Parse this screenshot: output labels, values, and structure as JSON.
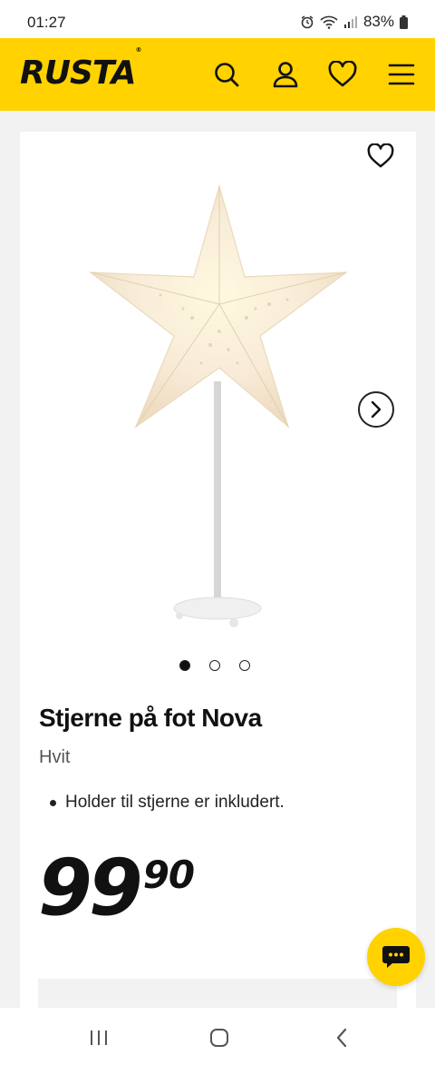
{
  "status_bar": {
    "time": "01:27",
    "battery": "83%"
  },
  "header": {
    "logo": "RUSTA",
    "icons": [
      "search-icon",
      "account-icon",
      "heart-icon",
      "menu-icon"
    ],
    "background": "#ffd200"
  },
  "product": {
    "title": "Stjerne på fot Nova",
    "variant": "Hvit",
    "bullets": [
      "Holder til stjerne er inkludert."
    ],
    "price": {
      "main": "99",
      "decimals": "90"
    },
    "carousel": {
      "total": 3,
      "active": 1
    }
  },
  "chat": {
    "icon": "chat-bubble-icon"
  },
  "nav": {
    "icons": [
      "recent-apps-icon",
      "home-icon",
      "back-icon"
    ]
  }
}
